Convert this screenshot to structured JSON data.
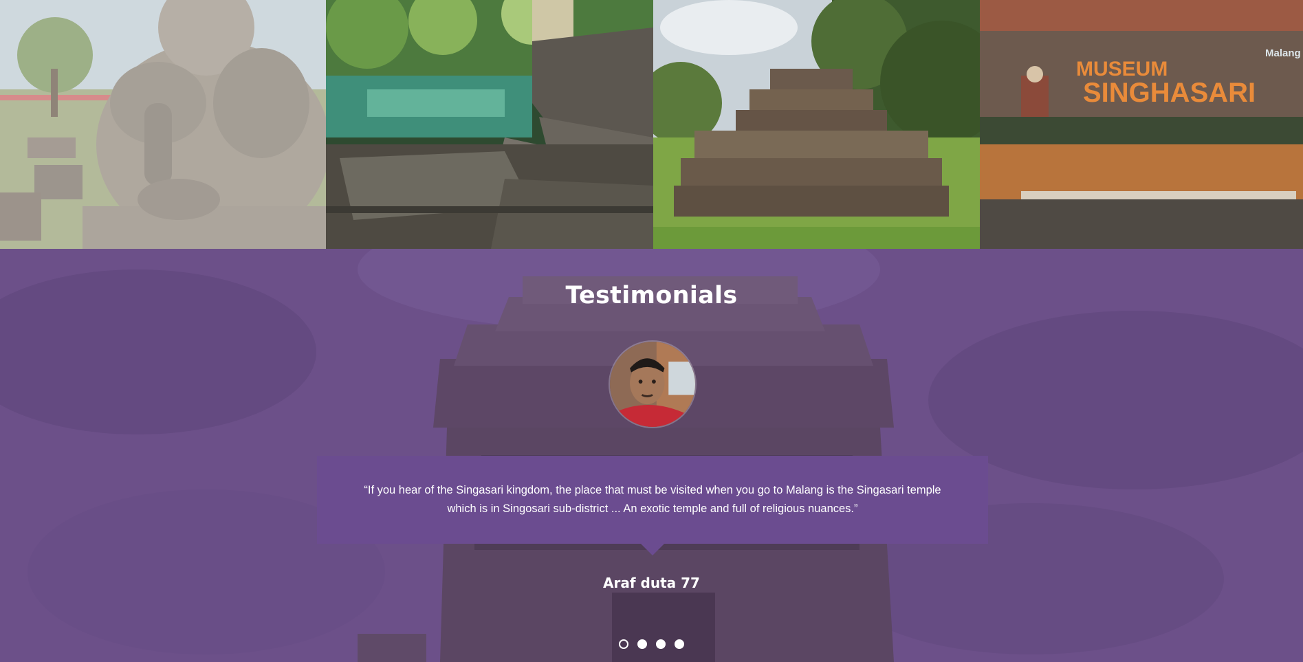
{
  "gallery": {
    "tiles": [
      {
        "subject": "ganesha-statue"
      },
      {
        "subject": "temple-pool-steps"
      },
      {
        "subject": "stupa-ruin"
      },
      {
        "subject": "museum-singhasari-sign"
      }
    ],
    "museum_sign": {
      "line1": "MUSEUM",
      "line2": "SINGHASARI",
      "city": "Malang"
    }
  },
  "testimonials": {
    "title": "Testimonials",
    "quote": "“If you hear of the Singasari kingdom, the place that must be visited when you go to Malang is the Singasari temple which is in Singosari sub-district ... An exotic temple and full of religious nuances.”",
    "author": "Araf duta 77",
    "slides_total": 4,
    "active_slide": 1,
    "colors": {
      "overlay": "#735797",
      "quote_box": "#6b4c90",
      "text": "#ffffff"
    }
  }
}
